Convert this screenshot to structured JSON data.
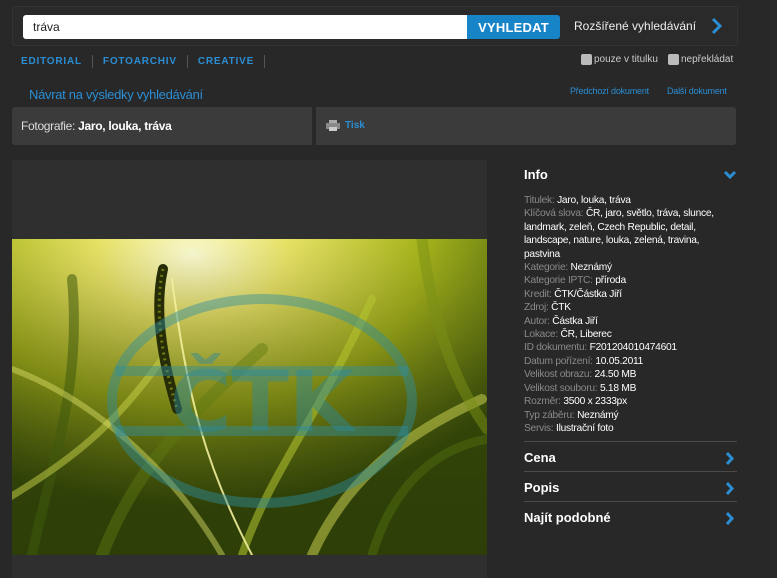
{
  "search": {
    "query": "tráva",
    "button_label": "VYHLEDAT",
    "advanced_label": "Rozšířené vyhledávání"
  },
  "sources": [
    "EDITORIAL",
    "FOTOARCHIV",
    "CREATIVE"
  ],
  "filters": {
    "title_only": "pouze v titulku",
    "no_translate": "nepřekládat"
  },
  "nav": {
    "back": "Návrat na výsledky vyhledávání",
    "prev_doc": "Předchozí dokument",
    "next_doc": "Další dokument"
  },
  "document": {
    "type_prefix": "Fotografie:",
    "title": "Jaro, louka, tráva",
    "print_label": "Tisk"
  },
  "photo": {
    "watermark": "ČTK"
  },
  "info": {
    "heading": "Info",
    "fields": [
      {
        "key": "Titulek:",
        "value": "Jaro, louka, tráva"
      },
      {
        "key": "Klíčová slova:",
        "value": "ČR, jaro, světlo, tráva, slunce, landmark, zeleň, Czech Republic, detail, landscape, nature, louka, zelená, travina, pastvina"
      },
      {
        "key": "Kategorie:",
        "value": "Neznámý"
      },
      {
        "key": "Kategorie IPTC:",
        "value": "příroda"
      },
      {
        "key": "Kredit:",
        "value": "ČTK/Částka Jiří"
      },
      {
        "key": "Zdroj:",
        "value": "ČTK"
      },
      {
        "key": "Autor:",
        "value": "Částka Jiří"
      },
      {
        "key": "Lokace:",
        "value": "ČR, Liberec"
      },
      {
        "key": "ID dokumentu:",
        "value": "F201204010474601"
      },
      {
        "key": "Datum pořízení:",
        "value": "10.05.2011"
      },
      {
        "key": "Velikost obrazu:",
        "value": "24.50 MB"
      },
      {
        "key": "Velikost souboru:",
        "value": "5.18 MB"
      },
      {
        "key": "Rozměr:",
        "value": "3500 x 2333px"
      },
      {
        "key": "Typ záběru:",
        "value": "Neznámý"
      },
      {
        "key": "Servis:",
        "value": "Ilustrační foto"
      }
    ]
  },
  "sections": [
    "Cena",
    "Popis",
    "Najít podobné"
  ],
  "colors": {
    "accent": "#2b8ed3",
    "button": "#1784c8",
    "background": "#282828",
    "panel": "#3b3b3b"
  }
}
